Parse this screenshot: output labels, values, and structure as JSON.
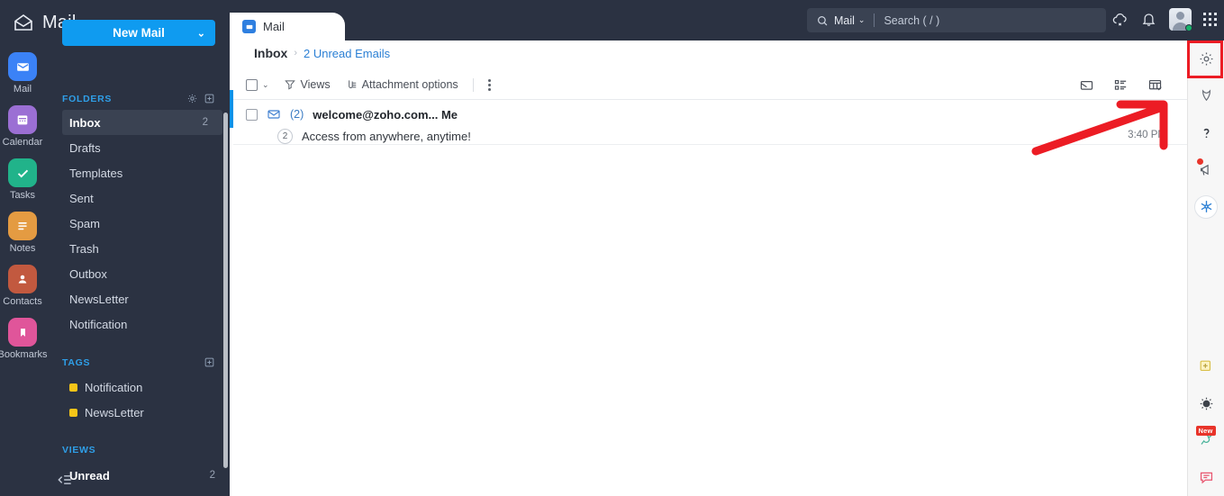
{
  "brand": {
    "logo_icon": "open-envelope-icon",
    "title": "Mail"
  },
  "app_rail": [
    {
      "label": "Mail",
      "icon": "mail-icon",
      "color": "#3b82f6"
    },
    {
      "label": "Calendar",
      "icon": "calendar-icon",
      "color": "#9b6fd4"
    },
    {
      "label": "Tasks",
      "icon": "check-icon",
      "color": "#21b38a"
    },
    {
      "label": "Notes",
      "icon": "notes-icon",
      "color": "#e49b42"
    },
    {
      "label": "Contacts",
      "icon": "contacts-icon",
      "color": "#c2593f"
    },
    {
      "label": "Bookmarks",
      "icon": "bookmark-icon",
      "color": "#e0559a"
    }
  ],
  "sidebar": {
    "new_mail_label": "New Mail",
    "new_mail_caret": "⌄",
    "folders_header": "FOLDERS",
    "folders_gear_icon": "gear-icon",
    "folders_add_icon": "plus-box-icon",
    "folders": [
      {
        "label": "Inbox",
        "count": "2",
        "active": true
      },
      {
        "label": "Drafts",
        "count": "",
        "active": false
      },
      {
        "label": "Templates",
        "count": "",
        "active": false
      },
      {
        "label": "Sent",
        "count": "",
        "active": false
      },
      {
        "label": "Spam",
        "count": "",
        "active": false
      },
      {
        "label": "Trash",
        "count": "",
        "active": false
      },
      {
        "label": "Outbox",
        "count": "",
        "active": false
      },
      {
        "label": "NewsLetter",
        "count": "",
        "active": false
      },
      {
        "label": "Notification",
        "count": "",
        "active": false
      }
    ],
    "tags_header": "TAGS",
    "tags_add_icon": "plus-box-icon",
    "tags": [
      {
        "label": "Notification",
        "color": "#f5c518"
      },
      {
        "label": "NewsLetter",
        "color": "#f5c518"
      }
    ],
    "views_header": "VIEWS",
    "views": [
      {
        "label": "Unread",
        "count": "2"
      }
    ],
    "collapse_icon": "collapse-sidebar-icon"
  },
  "header": {
    "tab": {
      "label": "Mail",
      "icon": "mail-tab-icon"
    },
    "search": {
      "scope_label": "Mail",
      "scope_caret": "⌄",
      "placeholder": "Search ( / )",
      "icon": "search-icon"
    },
    "icons": [
      {
        "name": "cloud-off-icon"
      },
      {
        "name": "bell-icon"
      },
      {
        "name": "avatar"
      },
      {
        "name": "apps-grid-icon"
      }
    ]
  },
  "main": {
    "breadcrumb": {
      "current": "Inbox",
      "separator": "›",
      "link": "2 Unread Emails"
    },
    "toolbar": {
      "select_all_checkbox": "select-all-checkbox",
      "select_caret": "⌄",
      "views_label": "Views",
      "views_icon": "filter-icon",
      "attachment_label": "Attachment options",
      "attachment_icon": "attachment-options-icon",
      "more_icon": "more-vertical-icon",
      "right_icons": [
        {
          "name": "mark-read-icon"
        },
        {
          "name": "list-view-icon"
        },
        {
          "name": "column-view-icon"
        }
      ]
    },
    "messages": [
      {
        "checkbox": "message-checkbox",
        "envelope_icon": "unread-envelope-icon",
        "thread_count": "(2)",
        "from": "welcome@zoho.com... Me",
        "bubble_count": "2",
        "subject": "Access from anywhere, anytime!",
        "time": "3:40 PM"
      }
    ]
  },
  "right_rail": {
    "top": [
      {
        "name": "settings-gear-icon",
        "highlighted": true
      },
      {
        "name": "feather-icon"
      },
      {
        "name": "help-question-icon"
      },
      {
        "name": "announcement-icon",
        "badge_dot": true
      },
      {
        "name": "integrations-icon"
      }
    ],
    "bottom": [
      {
        "name": "add-note-icon"
      },
      {
        "name": "theme-toggle-icon"
      },
      {
        "name": "plug-extensions-icon",
        "badge_text": "New"
      },
      {
        "name": "chat-icon"
      }
    ]
  },
  "annotation": {
    "highlight_color": "#ec1c24",
    "target": "settings-gear-icon"
  }
}
